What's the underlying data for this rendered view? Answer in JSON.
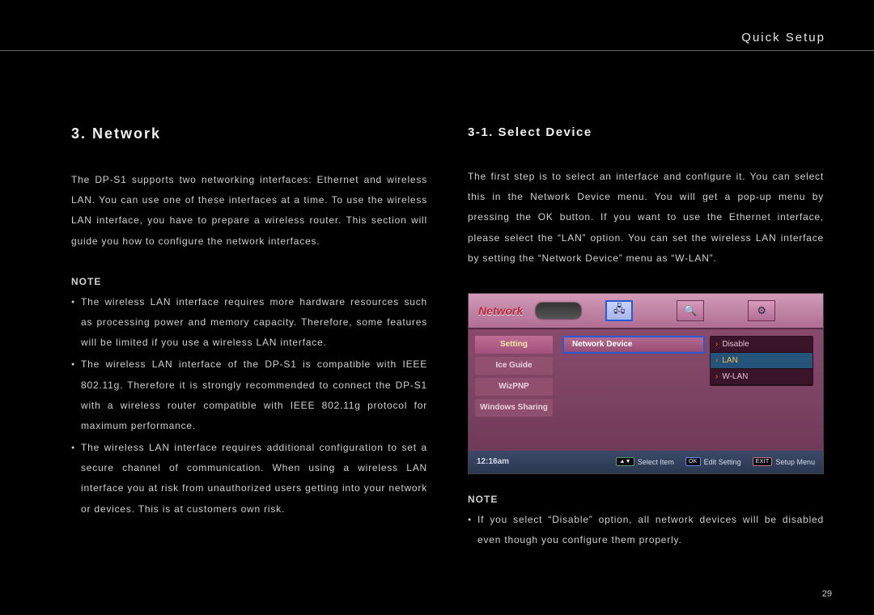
{
  "header": {
    "title": "Quick Setup"
  },
  "left": {
    "heading": "3. Network",
    "intro": "The DP-S1 supports two networking interfaces: Ethernet and wireless LAN. You can use one of these interfaces at a time. To use the wireless LAN interface, you have to prepare a wireless router. This section will guide you how to configure the network interfaces.",
    "note_label": "NOTE",
    "notes": [
      "The wireless LAN interface requires more hardware resources such as processing power and memory capacity. Therefore, some features will be limited if you use a wireless LAN interface.",
      "The wireless LAN interface of the DP-S1 is compatible with IEEE 802.11g. Therefore it is strongly recommended to connect the DP-S1 with a wireless router compatible with IEEE 802.11g protocol for maximum performance.",
      "The wireless LAN interface requires additional configuration to set a secure channel of communication. When using a wireless LAN interface you at risk from unauthorized users getting into your network or devices. This is at customers own risk."
    ]
  },
  "right": {
    "heading": "3-1. Select Device",
    "intro": "The first step is to select an interface and configure it. You can select this in the Network Device menu. You will get a pop-up menu by pressing the OK button. If you want to use the Ethernet interface, please select the “LAN” option. You can set the wireless LAN interface by setting the “Network Device” menu as “W-LAN”.",
    "note_label": "NOTE",
    "notes": [
      "If you select “Disable” option, all network devices will be disabled even though you configure them properly."
    ]
  },
  "screenshot": {
    "title": "Network",
    "sidebar": [
      "Setting",
      "Ice Guide",
      "WizPNP",
      "Windows Sharing"
    ],
    "field_label": "Network Device",
    "popup": [
      "Disable",
      "LAN",
      "W-LAN"
    ],
    "popup_selected_index": 1,
    "clock": "12:16am",
    "hints": [
      {
        "badge": "▲▼",
        "label": "Select Item"
      },
      {
        "badge": "OK",
        "label": "Edit Setting"
      },
      {
        "badge": "EXIT",
        "label": "Setup Menu"
      }
    ]
  },
  "page_number": "29"
}
